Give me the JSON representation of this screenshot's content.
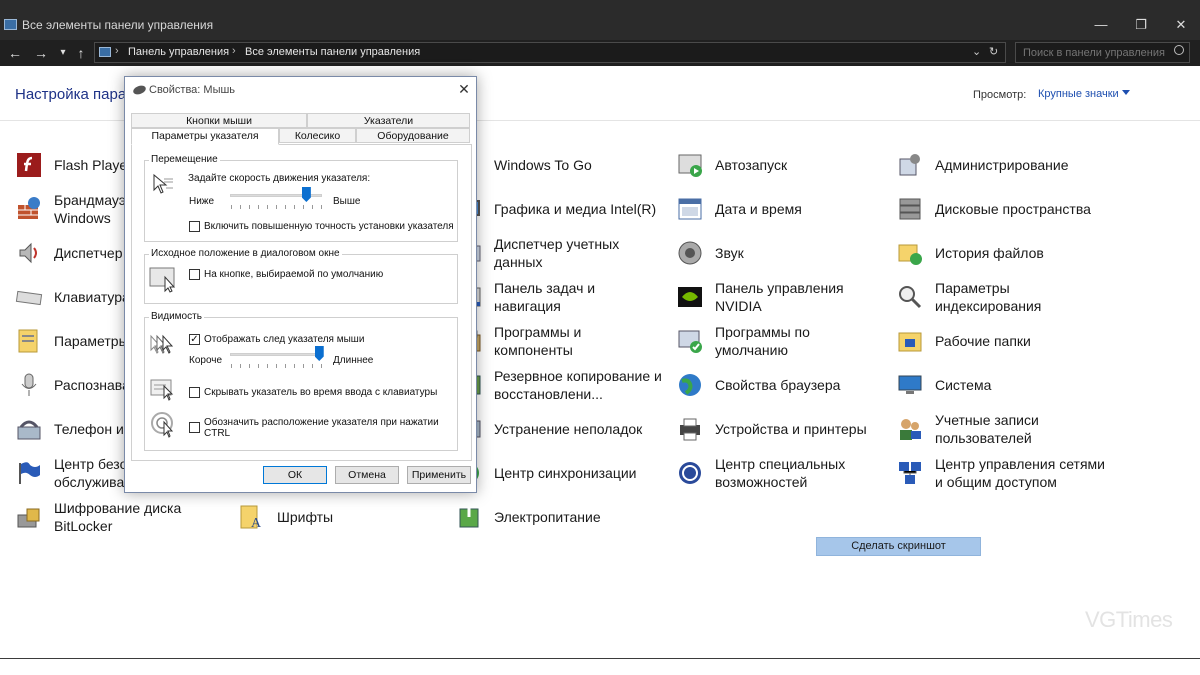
{
  "window": {
    "title": "Все элементы панели управления",
    "minimize": "—",
    "maximize": "❐",
    "close": "✕"
  },
  "address_bar": {
    "back": "←",
    "forward": "→",
    "history": "▾",
    "up": "↑",
    "crumbs": [
      "Панель управления",
      "Все элементы панели управления"
    ],
    "dropdown": "⌄",
    "refresh": "↻",
    "search_placeholder": "Поиск в панели управления"
  },
  "main": {
    "title": "Настройка парам",
    "view_label": "Просмотр:",
    "view_value": "Крупные значки"
  },
  "items": {
    "col1": [
      {
        "label": "Flash Player",
        "icon": "flash-icon"
      },
      {
        "label": "Брандмауэ\nWindows",
        "icon": "firewall-icon"
      },
      {
        "label": "Диспетчер",
        "icon": "speaker-icon"
      },
      {
        "label": "Клавиатура",
        "icon": "keyboard-icon"
      },
      {
        "label": "Параметры",
        "icon": "folder-options-icon"
      },
      {
        "label": "Распознава",
        "icon": "microphone-icon"
      },
      {
        "label": "Телефон и",
        "icon": "phone-icon"
      },
      {
        "label": "Центр безо\nобслужива",
        "icon": "flag-icon"
      },
      {
        "label": "Шифрование диска\nBitLocker",
        "icon": "bitlocker-icon"
      }
    ],
    "col2": [
      {
        "label": "Шрифты",
        "icon": "fonts-icon"
      }
    ],
    "col3": [
      {
        "label": "Windows To Go",
        "icon": "usb-icon"
      },
      {
        "label": "Графика и медиа Intel(R)",
        "icon": "intel-graphics-icon"
      },
      {
        "label": "Диспетчер учетных\nданных",
        "icon": "credential-icon"
      },
      {
        "label": "Панель задач и\nнавигация",
        "icon": "taskbar-icon"
      },
      {
        "label": "Программы и\nкомпоненты",
        "icon": "programs-icon"
      },
      {
        "label": "Резервное копирование и\nвосстановлени...",
        "icon": "backup-icon"
      },
      {
        "label": "Устранение неполадок",
        "icon": "troubleshoot-icon"
      },
      {
        "label": "Центр синхронизации",
        "icon": "sync-icon"
      },
      {
        "label": "Электропитание",
        "icon": "power-icon"
      }
    ],
    "col4": [
      {
        "label": "Автозапуск",
        "icon": "autoplay-icon"
      },
      {
        "label": "Дата и время",
        "icon": "calendar-icon"
      },
      {
        "label": "Звук",
        "icon": "sound-icon"
      },
      {
        "label": "Панель управления\nNVIDIA",
        "icon": "nvidia-icon"
      },
      {
        "label": "Программы по\nумолчанию",
        "icon": "default-programs-icon"
      },
      {
        "label": "Свойства браузера",
        "icon": "globe-icon"
      },
      {
        "label": "Устройства и принтеры",
        "icon": "printer-icon"
      },
      {
        "label": "Центр специальных\nвозможностей",
        "icon": "accessibility-icon"
      }
    ],
    "col5": [
      {
        "label": "Администрирование",
        "icon": "admin-tools-icon"
      },
      {
        "label": "Дисковые пространства",
        "icon": "storage-spaces-icon"
      },
      {
        "label": "История файлов",
        "icon": "file-history-icon"
      },
      {
        "label": "Параметры\nиндексирования",
        "icon": "indexing-icon"
      },
      {
        "label": "Рабочие папки",
        "icon": "work-folders-icon"
      },
      {
        "label": "Система",
        "icon": "computer-icon"
      },
      {
        "label": "Учетные записи\nпользователей",
        "icon": "users-icon"
      },
      {
        "label": "Центр управления сетями\nи общим доступом",
        "icon": "network-icon"
      }
    ]
  },
  "screenshot_button": "Сделать скриншот",
  "watermark": "VGTimes",
  "dialog": {
    "title": "Свойства: Мышь",
    "close": "✕",
    "tabs_back": [
      "Кнопки мыши",
      "Указатели"
    ],
    "tabs_front": [
      "Параметры указателя",
      "Колесико",
      "Оборудование"
    ],
    "motion": {
      "title": "Перемещение",
      "prompt": "Задайте скорость движения указателя:",
      "low": "Ниже",
      "high": "Выше",
      "speed_fraction": 0.83,
      "precision_label": "Включить повышенную точность установки указателя",
      "precision_checked": false
    },
    "snap": {
      "title": "Исходное положение в диалоговом окне",
      "label": "На кнопке, выбираемой по умолчанию",
      "checked": false
    },
    "visibility": {
      "title": "Видимость",
      "trails_label": "Отображать след указателя мыши",
      "trails_checked": true,
      "short": "Короче",
      "long": "Длиннее",
      "trail_fraction": 0.97,
      "hide_label": "Скрывать указатель во время ввода с клавиатуры",
      "hide_checked": false,
      "locate_label": "Обозначить расположение указателя при нажатии\nCTRL",
      "locate_checked": false,
      "check_mark": "✓"
    },
    "buttons": {
      "ok": "ОК",
      "cancel": "Отмена",
      "apply": "Применить"
    }
  }
}
